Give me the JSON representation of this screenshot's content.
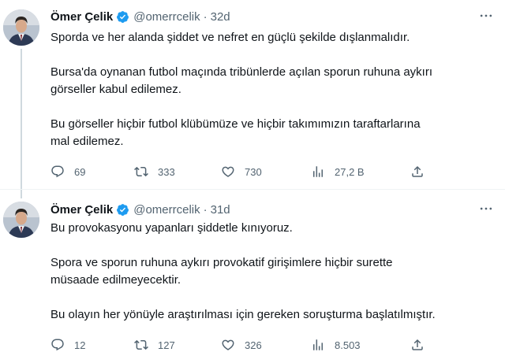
{
  "tweets": [
    {
      "author": {
        "name": "Ömer Çelik",
        "handle": "@omerrcelik",
        "separator": "·",
        "time": "32d"
      },
      "paragraphs": [
        "Sporda ve her alanda şiddet ve nefret en güçlü şekilde dışlanmalıdır.",
        "Bursa'da oynanan futbol maçında tribünlerde açılan sporun ruhuna aykırı\ngörseller kabul edilemez.",
        "Bu görseller hiçbir futbol klübümüze ve hiçbir takımımızın taraftarlarına\nmal edilemez."
      ],
      "stats": {
        "replies": "69",
        "retweets": "333",
        "likes": "730",
        "views": "27,2 B"
      }
    },
    {
      "author": {
        "name": "Ömer Çelik",
        "handle": "@omerrcelik",
        "separator": "·",
        "time": "31d"
      },
      "paragraphs": [
        "Bu provokasyonu yapanları şiddetle kınıyoruz.",
        "Spora ve sporun ruhuna aykırı provokatif girişimlere hiçbir surette\nmüsaade edilmeyecektir.",
        "Bu olayın her yönüyle araştırılması için gereken soruşturma başlatılmıştır."
      ],
      "stats": {
        "replies": "12",
        "retweets": "127",
        "likes": "326",
        "views": "8.503"
      }
    }
  ],
  "icons": {
    "more": "more-icon",
    "verified": "verified-badge-icon",
    "reply": "reply-icon",
    "retweet": "retweet-icon",
    "like": "heart-icon",
    "views": "views-icon",
    "share": "share-icon"
  },
  "colors": {
    "text": "#0f1419",
    "secondary": "#536471",
    "verified": "#1d9bf0",
    "thread_line": "#cfd9de"
  }
}
